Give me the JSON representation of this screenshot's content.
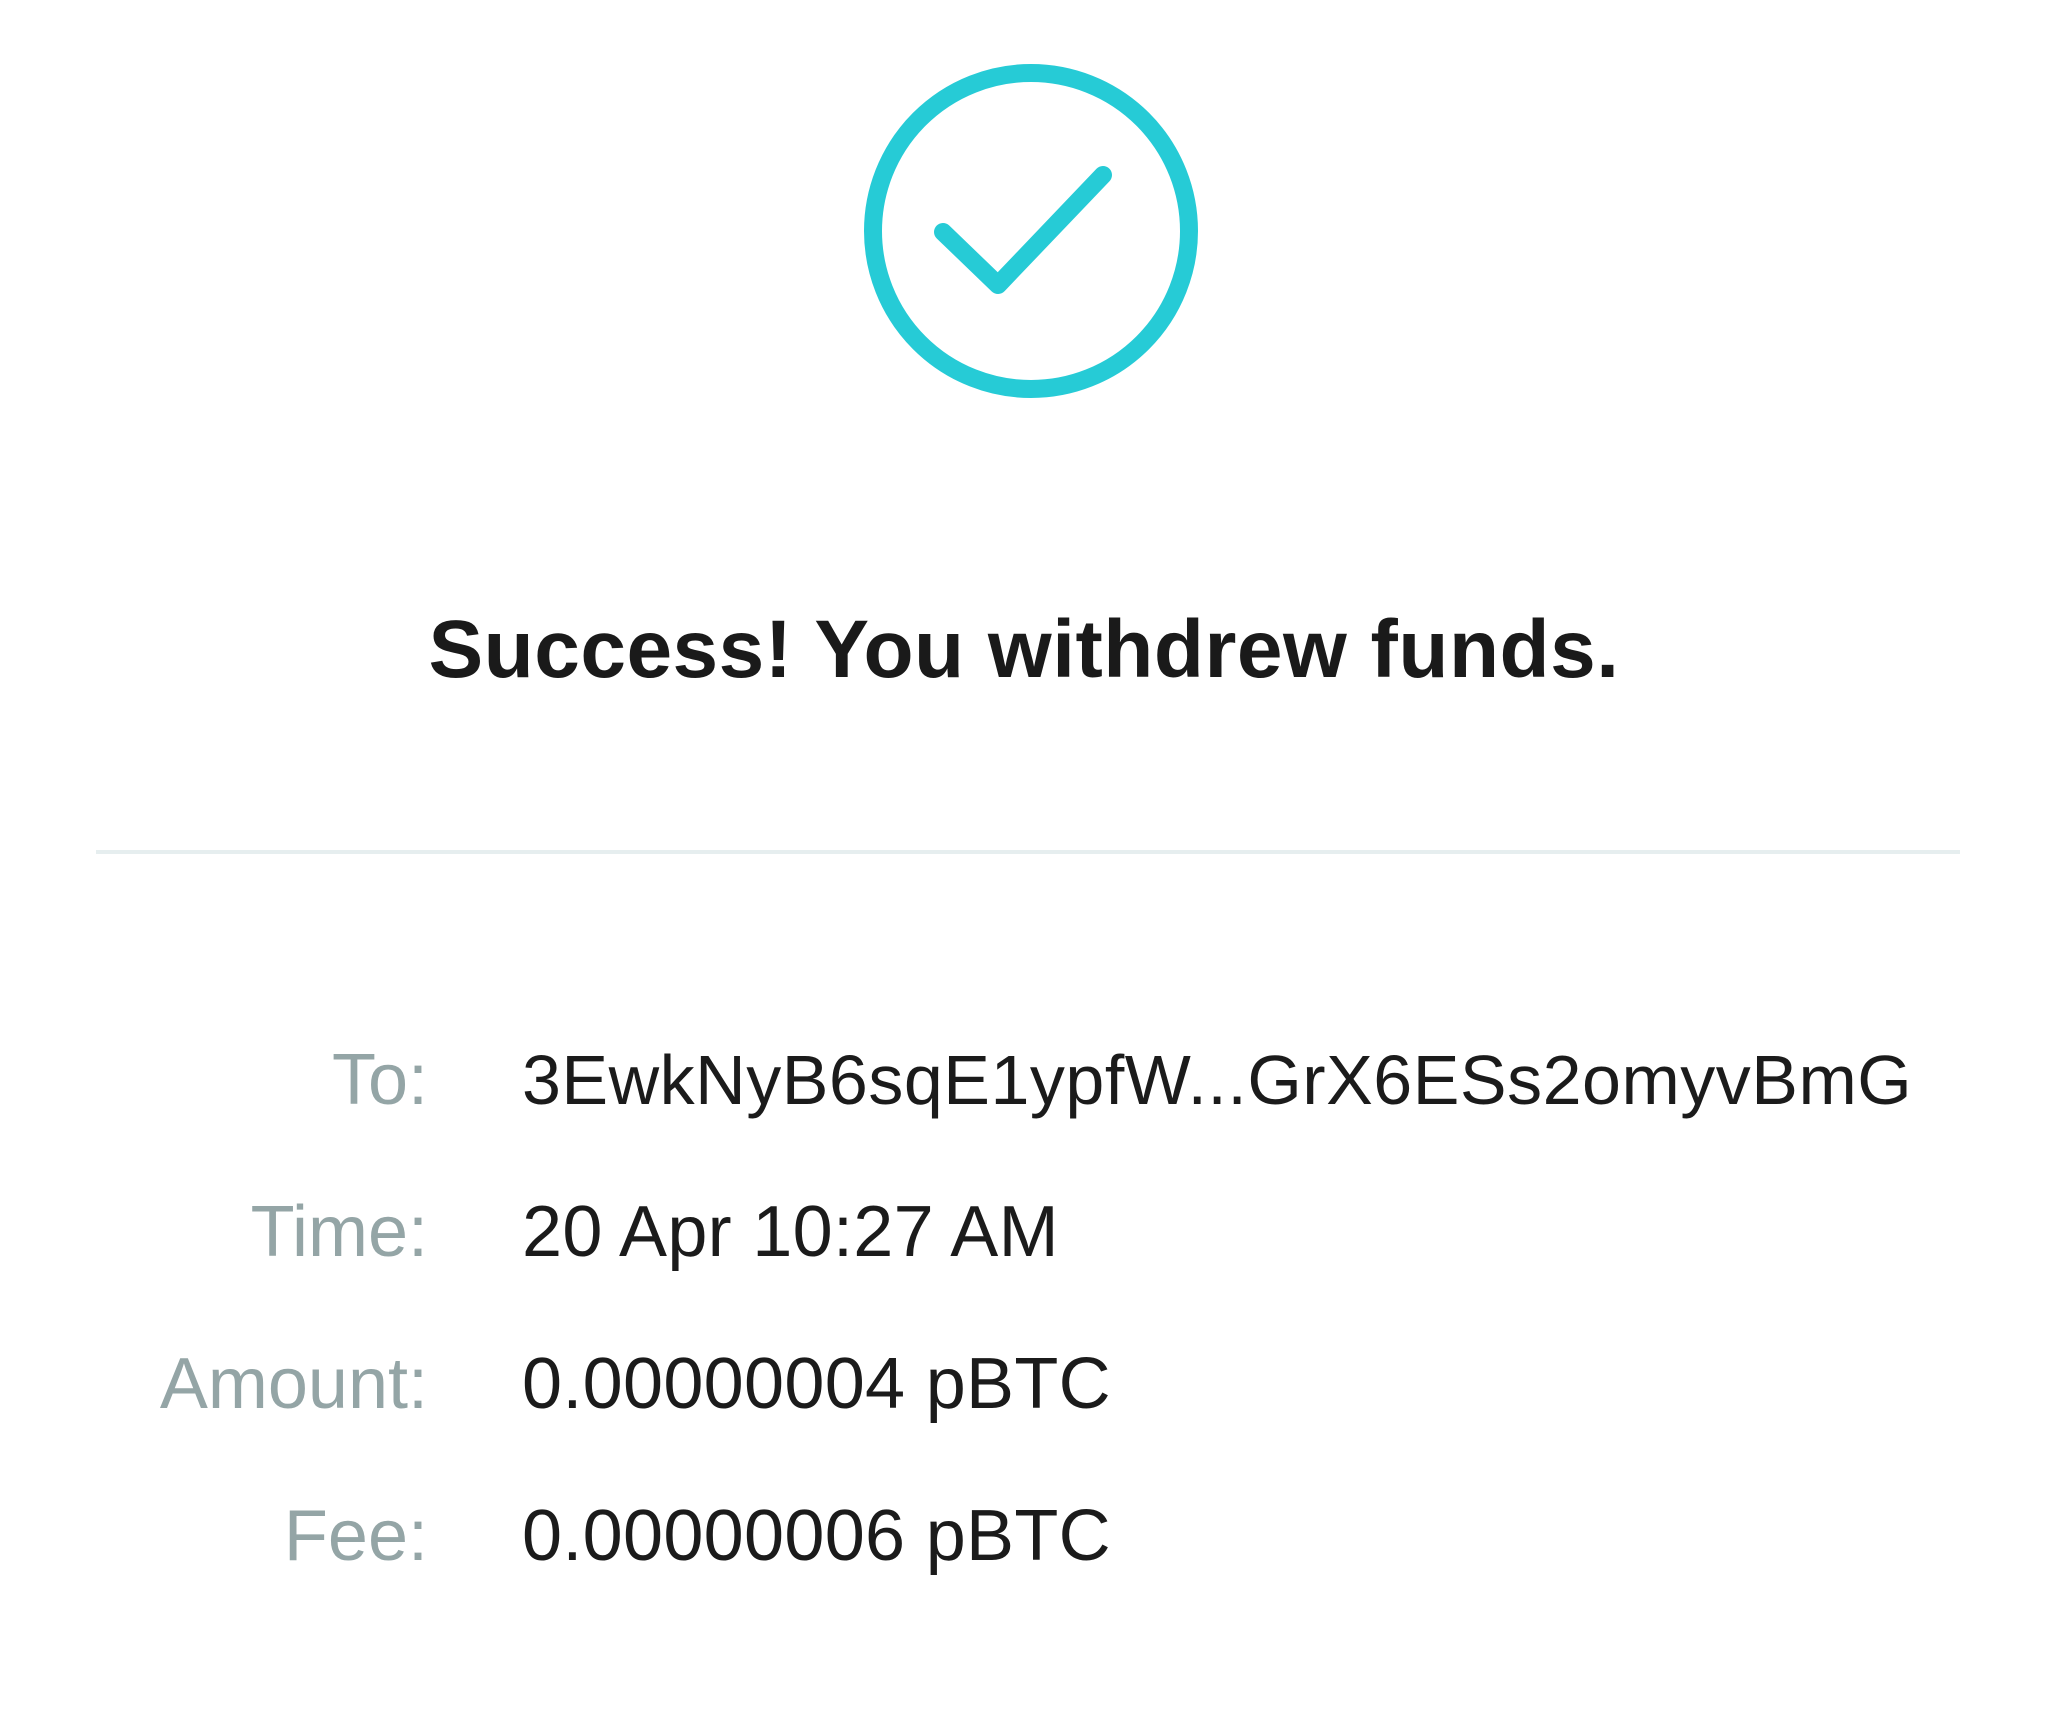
{
  "status": {
    "icon": "check-circle-icon",
    "accent_color": "#26cbd6",
    "headline": "Success! You withdrew funds."
  },
  "details": {
    "to": {
      "label": "To:",
      "value": "3EwkNyB6sqE1ypfW...GrX6ESs2omyvBmG"
    },
    "time": {
      "label": "Time:",
      "value": "20 Apr 10:27 AM"
    },
    "amount": {
      "label": "Amount:",
      "value": "0.00000004 pBTC"
    },
    "fee": {
      "label": "Fee:",
      "value": "0.00000006 pBTC"
    }
  }
}
